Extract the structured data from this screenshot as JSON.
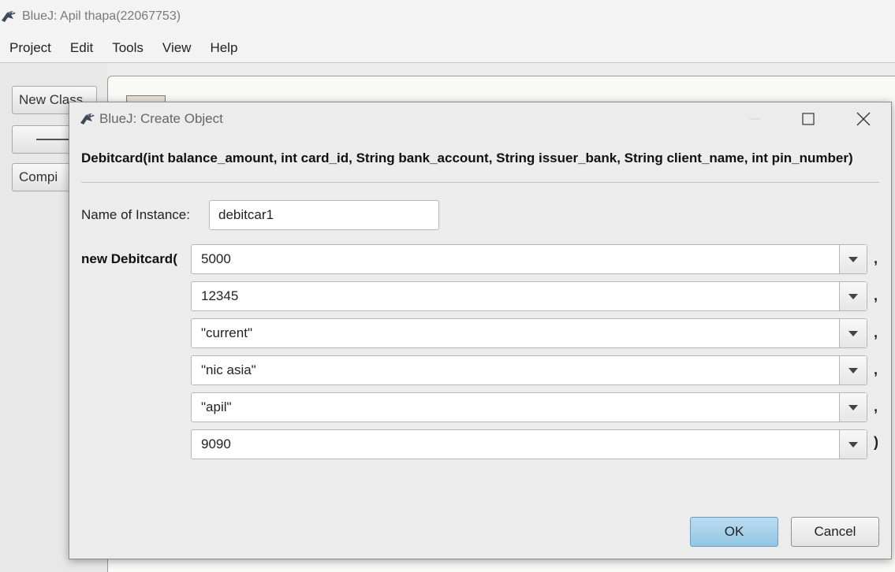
{
  "main_window": {
    "title": "BlueJ:  Apil thapa(22067753)",
    "menu": [
      "Project",
      "Edit",
      "Tools",
      "View",
      "Help"
    ],
    "side_buttons": {
      "new_class": "New Class",
      "compile": "Compi"
    }
  },
  "dialog": {
    "title": "BlueJ:  Create Object",
    "signature": "Debitcard(int balance_amount, int card_id, String bank_account, String issuer_bank, String client_name, int pin_number)",
    "instance_label": "Name of Instance:",
    "instance_value": "debitcar1",
    "constructor_label": "new Debitcard(",
    "params": [
      {
        "value": "5000",
        "suffix": ","
      },
      {
        "value": "12345",
        "suffix": ","
      },
      {
        "value": "\"current\"",
        "suffix": ","
      },
      {
        "value": "\"nic asia\"",
        "suffix": ","
      },
      {
        "value": "\"apil\"",
        "suffix": ","
      },
      {
        "value": "9090",
        "suffix": ")"
      }
    ],
    "ok_label": "OK",
    "cancel_label": "Cancel"
  },
  "icons": {
    "app_icon": "bluej-bird-icon",
    "minimize": "minimize-icon",
    "maximize": "maximize-icon",
    "close": "close-icon",
    "dropdown": "chevron-down-icon"
  }
}
